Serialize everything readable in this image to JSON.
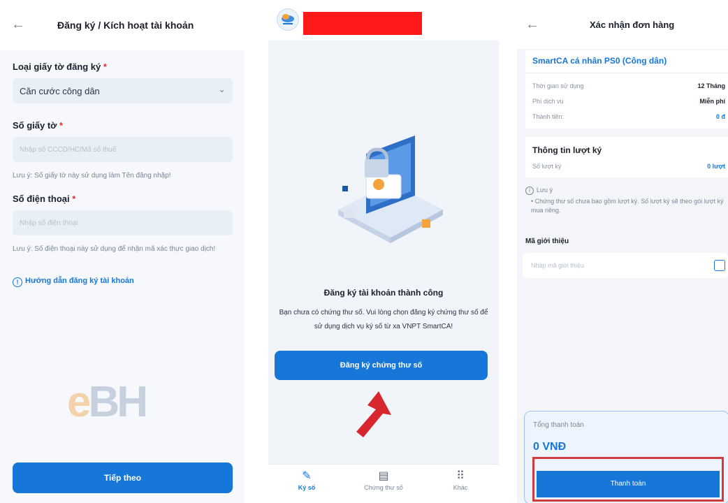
{
  "screen1": {
    "header": {
      "back_icon": "arrow-left-icon",
      "title": "Đăng ký / Kích hoạt tài khoản"
    },
    "doc_type": {
      "label": "Loại giấy tờ đăng ký",
      "value": "Căn cước công dân"
    },
    "doc_number": {
      "label": "Số giấy tờ",
      "placeholder": "Nhập số CCCD/HC/Mã số thuế",
      "note": "Lưu ý: Số giấy tờ này sử dụng làm Tên đăng nhập!"
    },
    "phone": {
      "label": "Số điện thoại",
      "placeholder": "Nhập số điện thoại",
      "note": "Lưu ý: Số điện thoại này sử dụng để nhận mã xác thực giao dịch!"
    },
    "guide_link": "Hướng dẫn đăng ký tài khoản",
    "watermark": {
      "left": "e",
      "right": "BH"
    },
    "next_button": "Tiếp theo",
    "required_mark": "*"
  },
  "screen2": {
    "success_title": "Đăng ký tài khoản thành công",
    "description": "Bạn chưa có chứng thư số. Vui lòng chọn đăng ký chứng thư số để sử dụng dịch vụ ký số từ xa VNPT SmartCA!",
    "register_button": "Đăng ký chứng thư số",
    "tabs": [
      {
        "label": "Ký số",
        "icon": "pen-icon",
        "active": true
      },
      {
        "label": "Chứng thư số",
        "icon": "certificate-icon",
        "active": false
      },
      {
        "label": "Khác",
        "icon": "grid-icon",
        "active": false
      }
    ]
  },
  "screen3": {
    "header": {
      "title": "Xác nhận đơn hàng"
    },
    "package": {
      "name": "SmartCA cá nhân PS0 (Công dân)",
      "rows": [
        {
          "label": "Thời gian sử dụng",
          "value": "12 Tháng"
        },
        {
          "label": "Phí dịch vụ",
          "value": "Miễn phí"
        },
        {
          "label": "Thành tiền:",
          "value": "0 đ"
        }
      ]
    },
    "sign_info": {
      "title": "Thông tin lượt ký",
      "label": "Số lượt ký",
      "value": "0 lượt"
    },
    "notice": {
      "title": "Lưu ý",
      "text": "• Chứng thư số chưa bao gồm lượt ký. Số lượt ký sẽ theo gói lượt ký mua riêng."
    },
    "referral": {
      "label": "Mã giới thiệu",
      "placeholder": "Nhập mã giới thiệu"
    },
    "total": {
      "label": "Tổng thanh toán",
      "value": "0 VNĐ"
    },
    "pay_button": "Thanh toán"
  },
  "colors": {
    "primary": "#1677d9",
    "highlight": "#d23b3b",
    "redaction": "#ff1a1a",
    "required": "#e03131"
  }
}
